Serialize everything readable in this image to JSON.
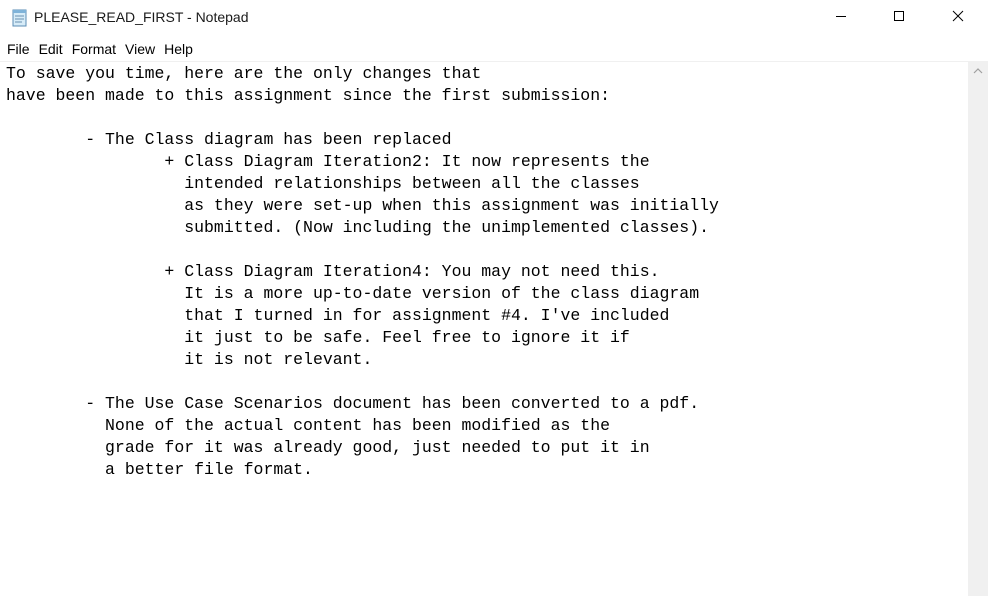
{
  "window": {
    "title": "PLEASE_READ_FIRST - Notepad",
    "app_icon": "notepad-icon",
    "controls": {
      "minimize_icon": "minimize-icon",
      "maximize_icon": "maximize-icon",
      "close_icon": "close-icon"
    }
  },
  "menu": {
    "items": [
      {
        "label": "File"
      },
      {
        "label": "Edit"
      },
      {
        "label": "Format"
      },
      {
        "label": "View"
      },
      {
        "label": "Help"
      }
    ]
  },
  "editor": {
    "lines": [
      "To save you time, here are the only changes that",
      "have been made to this assignment since the first submission:",
      "",
      "        - The Class diagram has been replaced",
      "                + Class Diagram Iteration2: It now represents the",
      "                  intended relationships between all the classes",
      "                  as they were set-up when this assignment was initially",
      "                  submitted. (Now including the unimplemented classes).",
      "",
      "                + Class Diagram Iteration4: You may not need this.",
      "                  It is a more up-to-date version of the class diagram",
      "                  that I turned in for assignment #4. I've included",
      "                  it just to be safe. Feel free to ignore it if",
      "                  it is not relevant.",
      "",
      "        - The Use Case Scenarios document has been converted to a pdf.",
      "          None of the actual content has been modified as the",
      "          grade for it was already good, just needed to put it in",
      "          a better file format."
    ]
  },
  "scrollbar": {
    "up_icon": "scroll-up-arrow-icon"
  }
}
